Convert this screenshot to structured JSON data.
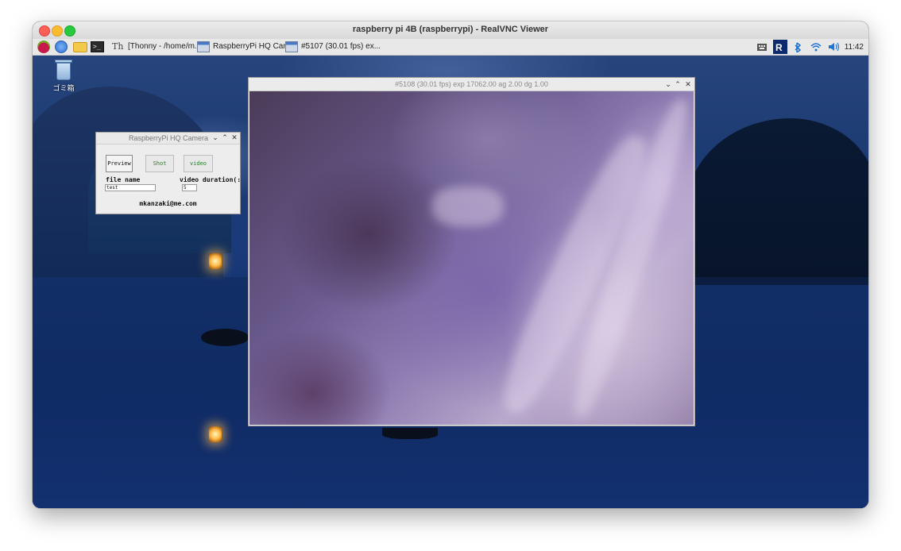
{
  "mac_window": {
    "title": "raspberry pi 4B (raspberrypi) - RealVNC Viewer"
  },
  "taskbar": {
    "tasks": [
      {
        "label": "[Thonny  -  /home/m..."
      },
      {
        "label": "RaspberryPi HQ Cam..."
      },
      {
        "label": "#5107 (30.01 fps) ex..."
      }
    ],
    "clock": "11:42"
  },
  "desktop": {
    "trash_label": "ゴミ箱"
  },
  "hq_camera": {
    "title": "RaspberryPi HQ Camera",
    "preview_label": "Preview",
    "shot_label": "Shot",
    "video_label": "video",
    "file_name_label": "file name",
    "file_name_value": "test",
    "video_duration_label": "video duration(:",
    "video_duration_value": "5",
    "email": "mkanzaki@me.com"
  },
  "preview_window": {
    "title": "#5108 (30.01 fps) exp 17062.00 ag 2.00 dg 1.00"
  },
  "window_controls": {
    "minimize": "⌄",
    "maximize": "⌃",
    "close": "✕"
  },
  "colors": {
    "accent_green_text": "#2a7a2a",
    "taskbar_bg": "#e8e8e8"
  }
}
